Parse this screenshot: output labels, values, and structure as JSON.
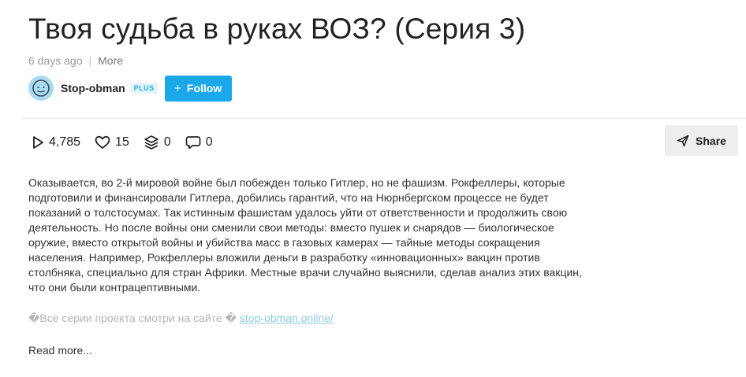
{
  "video": {
    "title": "Твоя судьба в руках ВОЗ? (Серия 3)",
    "uploaded": "6 days ago",
    "more_label": "More"
  },
  "author": {
    "name": "Stop-obman",
    "badge": "PLUS",
    "follow_icon": "+",
    "follow_label": "Follow"
  },
  "stats": {
    "views": "4,785",
    "likes": "15",
    "reposts": "0",
    "comments": "0"
  },
  "share_label": "Share",
  "description": {
    "text": "Оказывается, во 2-й мировой войне был побежден только Гитлер, но не фашизм. Рокфеллеры, которые подготовили и финансировали Гитлера, добились гарантий, что на Нюрнбергском процессе не будет показаний о толстосумах. Так истинным фашистам удалось уйти от ответственности и продолжить свою деятельность. Но после войны они сменили свои методы: вместо пушек и снарядов — биологическое оружие, вместо открытой войны и убийства масс в газовых камерах — тайные методы сокращения населения. Например, Рокфеллеры вложили деньги в разработку «инновационных» вакцин против столбняка, специально для стран Африки. Местные врачи случайно выяснили, сделав анализ этих вакцин, что они были контрацептивными.",
    "series_text": "�Все серии проекта смотри на сайте � ",
    "series_link": "stop-obman.online/",
    "read_more": "Read more..."
  },
  "colors": {
    "accent": "#1aa8ea",
    "avatar_bg": "#a9dcf3",
    "link": "#8fc8e3"
  },
  "icons": [
    "play-icon",
    "heart-icon",
    "layers-icon",
    "comment-icon",
    "send-icon",
    "avatar-face-icon"
  ]
}
